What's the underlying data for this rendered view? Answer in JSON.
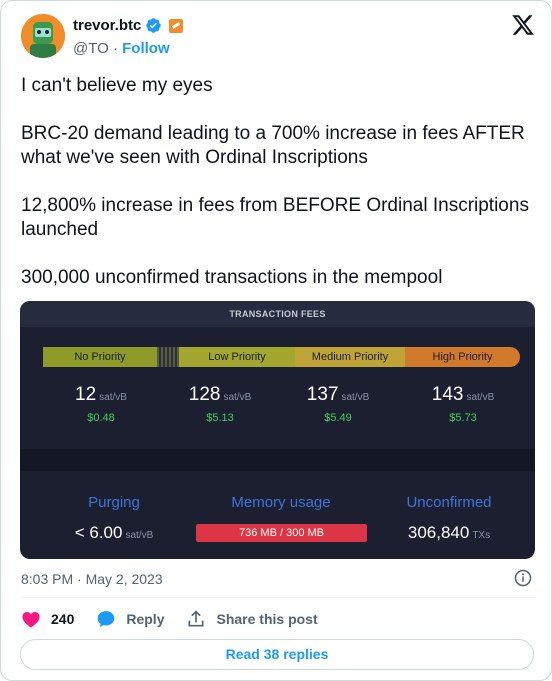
{
  "author": {
    "name": "trevor.btc",
    "handle": "@TO",
    "separator": "·",
    "follow_label": "Follow"
  },
  "tweet": {
    "paragraphs": [
      "I can't believe my eyes",
      "BRC-20 demand leading to a 700% increase in fees AFTER what we've seen with Ordinal Inscriptions",
      "12,800% increase in fees from BEFORE Ordinal Inscriptions launched",
      "300,000 unconfirmed transactions in the mempool"
    ],
    "timestamp": "8:03 PM · May 2, 2023"
  },
  "fees_image": {
    "title": "TRANSACTION FEES",
    "unit": "sat/vB",
    "priorities": [
      {
        "label": "No Priority",
        "value": "12",
        "usd": "$0.48"
      },
      {
        "label": "Low Priority",
        "value": "128",
        "usd": "$5.13"
      },
      {
        "label": "Medium Priority",
        "value": "137",
        "usd": "$5.49"
      },
      {
        "label": "High Priority",
        "value": "143",
        "usd": "$5.73"
      }
    ],
    "stats": {
      "purging_label": "Purging",
      "purging_value": "< 6.00",
      "purging_unit": "sat/vB",
      "memory_label": "Memory usage",
      "memory_value": "736 MB / 300 MB",
      "unconfirmed_label": "Unconfirmed",
      "unconfirmed_value": "306,840",
      "unconfirmed_unit": "TXs"
    },
    "colors": {
      "no_priority": "#8f9b28",
      "low_priority": "#a3a72f",
      "medium_priority": "#bfa336",
      "high_priority": "#d27a2c",
      "usd_green": "#3ecf5a",
      "stat_blue": "#3d73d9",
      "memory_red": "#dc3545"
    }
  },
  "actions": {
    "likes": "240",
    "reply_label": "Reply",
    "share_label": "Share this post",
    "read_replies_label": "Read 38 replies"
  },
  "icons": {
    "verified": "verified-check-icon",
    "affiliate": "affiliate-badge-icon",
    "x_logo": "x-logo-icon",
    "info": "info-icon",
    "like": "heart-icon",
    "reply": "speech-bubble-icon",
    "share": "share-icon"
  },
  "theme": {
    "accent": "#1d9bf0",
    "heart": "#f91880",
    "text_secondary": "#536471"
  }
}
